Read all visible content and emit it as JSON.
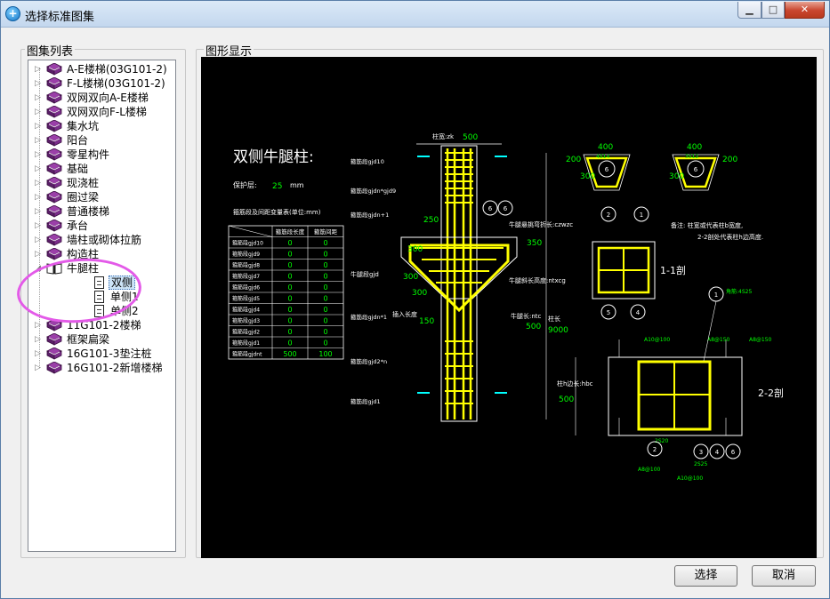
{
  "window": {
    "title": "选择标准图集",
    "min_glyph": "▁",
    "max_glyph": "□",
    "close_glyph": "✕"
  },
  "left_panel": {
    "label": "图集列表"
  },
  "right_panel": {
    "label": "图形显示"
  },
  "tree": {
    "items_before": [
      {
        "label": "A-E楼梯(03G101-2)"
      },
      {
        "label": "F-L楼梯(03G101-2)"
      },
      {
        "label": "双网双向A-E楼梯"
      },
      {
        "label": "双网双向F-L楼梯"
      },
      {
        "label": "集水坑"
      },
      {
        "label": "阳台"
      },
      {
        "label": "零星构件"
      },
      {
        "label": "基础"
      },
      {
        "label": "现浇桩"
      },
      {
        "label": "圈过梁"
      },
      {
        "label": "普通楼梯"
      },
      {
        "label": "承台"
      },
      {
        "label": "墙柱或砌体拉筋"
      },
      {
        "label": "构造柱"
      }
    ],
    "expanded": {
      "label": "牛腿柱",
      "children": [
        {
          "label": "双侧",
          "selected": true
        },
        {
          "label": "单侧1",
          "selected": false
        },
        {
          "label": "单侧2",
          "selected": false
        }
      ]
    },
    "items_after": [
      {
        "label": "11G101-2楼梯"
      },
      {
        "label": "框架扁梁"
      },
      {
        "label": "16G101-3垫注桩"
      },
      {
        "label": "16G101-2新增楼梯"
      }
    ],
    "icons": {
      "expander_collapsed": "▷",
      "expander_expanded": "◢",
      "folder": "book-icon",
      "leaf": "document-icon"
    }
  },
  "drawing": {
    "title": "双侧牛腿柱:",
    "cover_label": "保护层:",
    "cover_value": "25",
    "cover_unit": "mm",
    "table_title": "箍筋段及间距变量表(单位:mm)",
    "table_headers": [
      "箍筋段长度",
      "箍筋间距"
    ],
    "table_rows": [
      {
        "name": "箍筋段gjd10",
        "len": "0",
        "gap": "0"
      },
      {
        "name": "箍筋段gjd9",
        "len": "0",
        "gap": "0"
      },
      {
        "name": "箍筋段gjd8",
        "len": "0",
        "gap": "0"
      },
      {
        "name": "箍筋段gjd7",
        "len": "0",
        "gap": "0"
      },
      {
        "name": "箍筋段gjd6",
        "len": "0",
        "gap": "0"
      },
      {
        "name": "箍筋段gjd5",
        "len": "0",
        "gap": "0"
      },
      {
        "name": "箍筋段gjd4",
        "len": "0",
        "gap": "0"
      },
      {
        "name": "箍筋段gjd3",
        "len": "0",
        "gap": "0"
      },
      {
        "name": "箍筋段gjd2",
        "len": "0",
        "gap": "0"
      },
      {
        "name": "箍筋段gjd1",
        "len": "0",
        "gap": "0"
      },
      {
        "name": "箍筋段gjdnt",
        "len": "500",
        "gap": "100"
      }
    ],
    "col_width_label": "柱宽:zk",
    "col_width": "500",
    "dim_250": "250",
    "dim_300a": "300",
    "dim_300b": "300",
    "dim_300c": "300",
    "dim_350": "350",
    "dim_150": "150",
    "bracket_len_label": "牛腿长:ntc",
    "bracket_len": "500",
    "col_len_label": "柱长",
    "col_len": "9000",
    "insert_label": "插入长度",
    "bend_label": "牛腿悬挑弯折长:czwzc",
    "slope_label": "牛腿斜长高度:ntxcg",
    "bracket_seg_label": "牛腿段gjd",
    "seg_labels": [
      "箍筋段gjd10",
      "箍筋段gjdn*gjd9",
      "箍筋段gjdn+1",
      "箍筋段gjdn*1",
      "箍筋段gjd2*n",
      "箍筋段gjd1"
    ],
    "note_lines": [
      "备注: 柱宽或代表柱b宽度,",
      "2-2剖处代表柱h边高度."
    ],
    "sec1_label": "1-1剖",
    "sec2_label": "2-2剖",
    "sec2_dim_label": "柱h边长:hbc",
    "sec2_dim": "500",
    "bracket_sections": [
      {
        "top": "400",
        "left": "200",
        "bottom": "300",
        "rebar": "4S14",
        "no": "6"
      },
      {
        "top": "400",
        "right": "200",
        "bottom": "300",
        "rebar": "3S12",
        "no": "6"
      }
    ],
    "rebar_labels": [
      "A10@100",
      "A8@150",
      "A8@150",
      "2S20",
      "2S25",
      "A8@100",
      "A10@100",
      "角筋:4S25"
    ],
    "circle_nums": [
      "1",
      "2",
      "3",
      "4",
      "5",
      "6"
    ]
  },
  "buttons": {
    "select": "选择",
    "cancel": "取消"
  },
  "colors": {
    "drawing_bg": "#000000",
    "yellow": "#ffff00",
    "green": "#00ff00",
    "cyan": "#00ffff",
    "white": "#ffffff",
    "annotation": "#e35ae8"
  }
}
